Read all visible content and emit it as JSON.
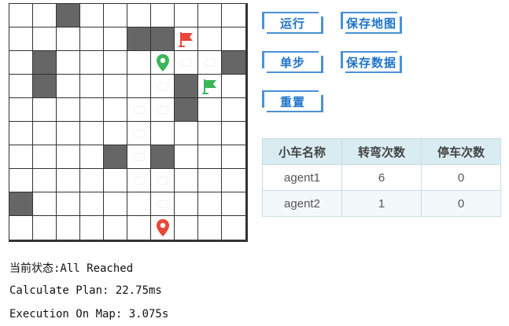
{
  "grid": {
    "rows": 10,
    "cols": 10,
    "obstacles": [
      [
        0,
        2
      ],
      [
        1,
        5
      ],
      [
        1,
        6
      ],
      [
        2,
        1
      ],
      [
        2,
        9
      ],
      [
        3,
        1
      ],
      [
        3,
        7
      ],
      [
        4,
        7
      ],
      [
        6,
        4
      ],
      [
        6,
        6
      ],
      [
        8,
        0
      ]
    ],
    "trail": [
      [
        2,
        7
      ],
      [
        2,
        8
      ],
      [
        3,
        6
      ],
      [
        4,
        5
      ],
      [
        4,
        6
      ],
      [
        5,
        5
      ],
      [
        6,
        5
      ],
      [
        7,
        5
      ],
      [
        7,
        6
      ],
      [
        8,
        6
      ]
    ],
    "markers": [
      {
        "row": 1,
        "col": 7,
        "icon": "red-flag-icon",
        "color": "#e8473a"
      },
      {
        "row": 2,
        "col": 6,
        "icon": "green-location-pin-icon",
        "color": "#3bb55a"
      },
      {
        "row": 3,
        "col": 8,
        "icon": "green-flag-icon",
        "color": "#3bb55a"
      },
      {
        "row": 9,
        "col": 6,
        "icon": "red-location-pin-icon",
        "color": "#e8473a"
      }
    ]
  },
  "buttons": {
    "run": "运行",
    "save_map": "保存地图",
    "step": "单步",
    "save_data": "保存数据",
    "reset": "重置"
  },
  "table": {
    "headers": [
      "小车名称",
      "转弯次数",
      "停车次数"
    ],
    "rows": [
      [
        "agent1",
        "6",
        "0"
      ],
      [
        "agent2",
        "1",
        "0"
      ]
    ]
  },
  "status": {
    "state": "当前状态:All Reached",
    "calculate": "Calculate Plan: 22.75ms",
    "execution": "Execution On Map: 3.075s"
  },
  "colors": {
    "obstacle": "#666666",
    "button_border": "#4a90d9",
    "button_text": "#1e73c8",
    "table_header": "#d9ecf2"
  }
}
